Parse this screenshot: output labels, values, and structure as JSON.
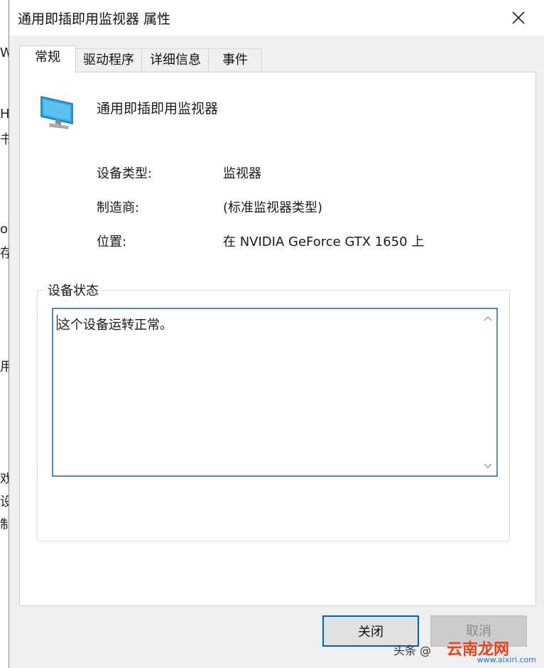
{
  "background_fragments": [
    "W",
    "H",
    "书",
    "o",
    "存",
    "用",
    "戏",
    "设",
    "制"
  ],
  "dialog": {
    "title": "通用即插即用监视器 属性",
    "close_glyph": "✕"
  },
  "tabs": [
    {
      "label": "常规",
      "active": true
    },
    {
      "label": "驱动程序",
      "active": false
    },
    {
      "label": "详细信息",
      "active": false
    },
    {
      "label": "事件",
      "active": false
    }
  ],
  "general": {
    "device_name": "通用即插即用监视器",
    "device_icon": "monitor-icon",
    "properties": [
      {
        "label": "设备类型:",
        "value": "监视器"
      },
      {
        "label": "制造商:",
        "value": "(标准监视器类型)"
      },
      {
        "label": "位置:",
        "value": "在 NVIDIA GeForce GTX 1650 上"
      }
    ],
    "status_group_title": "设备状态",
    "status_text": "这个设备运转正常。"
  },
  "buttons": {
    "close_label": "关闭",
    "cancel_label": "取消"
  },
  "watermark": {
    "prefix": "头条 @",
    "brand": "云南龙网",
    "url": "www.aixiri.com"
  },
  "colors": {
    "accent": "#0063b1",
    "status_border": "#5a8ab8",
    "watermark_brand": "#e8411b"
  }
}
